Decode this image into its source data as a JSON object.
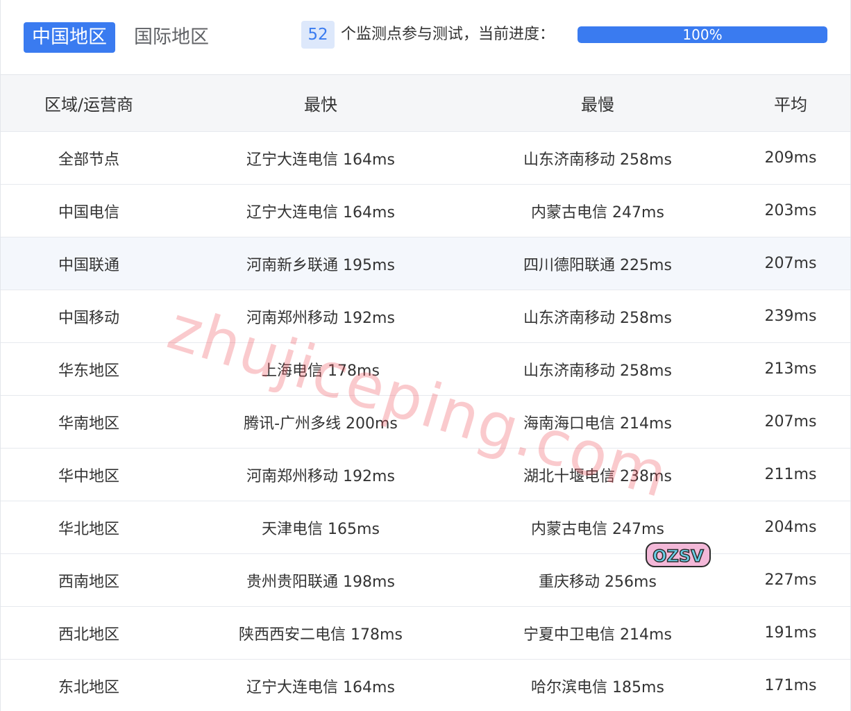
{
  "tabs": [
    {
      "label": "中国地区",
      "active": true
    },
    {
      "label": "国际地区",
      "active": false
    }
  ],
  "progress": {
    "count": "52",
    "label": "个监测点参与测试，当前进度：",
    "percent_text": "100%",
    "percent": 100
  },
  "table": {
    "headers": [
      "区域/运营商",
      "最快",
      "最慢",
      "平均"
    ],
    "rows": [
      [
        "全部节点",
        "辽宁大连电信 164ms",
        "山东济南移动 258ms",
        "209ms"
      ],
      [
        "中国电信",
        "辽宁大连电信 164ms",
        "内蒙古电信 247ms",
        "203ms"
      ],
      [
        "中国联通",
        "河南新乡联通 195ms",
        "四川德阳联通 225ms",
        "207ms"
      ],
      [
        "中国移动",
        "河南郑州移动 192ms",
        "山东济南移动 258ms",
        "239ms"
      ],
      [
        "华东地区",
        "上海电信 178ms",
        "山东济南移动 258ms",
        "213ms"
      ],
      [
        "华南地区",
        "腾讯-广州多线 200ms",
        "海南海口电信 214ms",
        "207ms"
      ],
      [
        "华中地区",
        "河南郑州移动 192ms",
        "湖北十堰电信 238ms",
        "211ms"
      ],
      [
        "华北地区",
        "天津电信 165ms",
        "内蒙古电信 247ms",
        "204ms"
      ],
      [
        "西南地区",
        "贵州贵阳联通 198ms",
        "重庆移动 256ms",
        "227ms"
      ],
      [
        "西北地区",
        "陕西西安二电信 178ms",
        "宁夏中卫电信 214ms",
        "191ms"
      ],
      [
        "东北地区",
        "辽宁大连电信 164ms",
        "哈尔滨电信 185ms",
        "171ms"
      ]
    ],
    "highlighted_row": 2
  },
  "watermark": "zhujiceping.com",
  "sticker_text": "OZSV",
  "colors": {
    "accent": "#3a7bf0",
    "badge_bg": "#dde8fb",
    "header_bg": "#f5f6f8",
    "watermark": "#f0505a"
  }
}
